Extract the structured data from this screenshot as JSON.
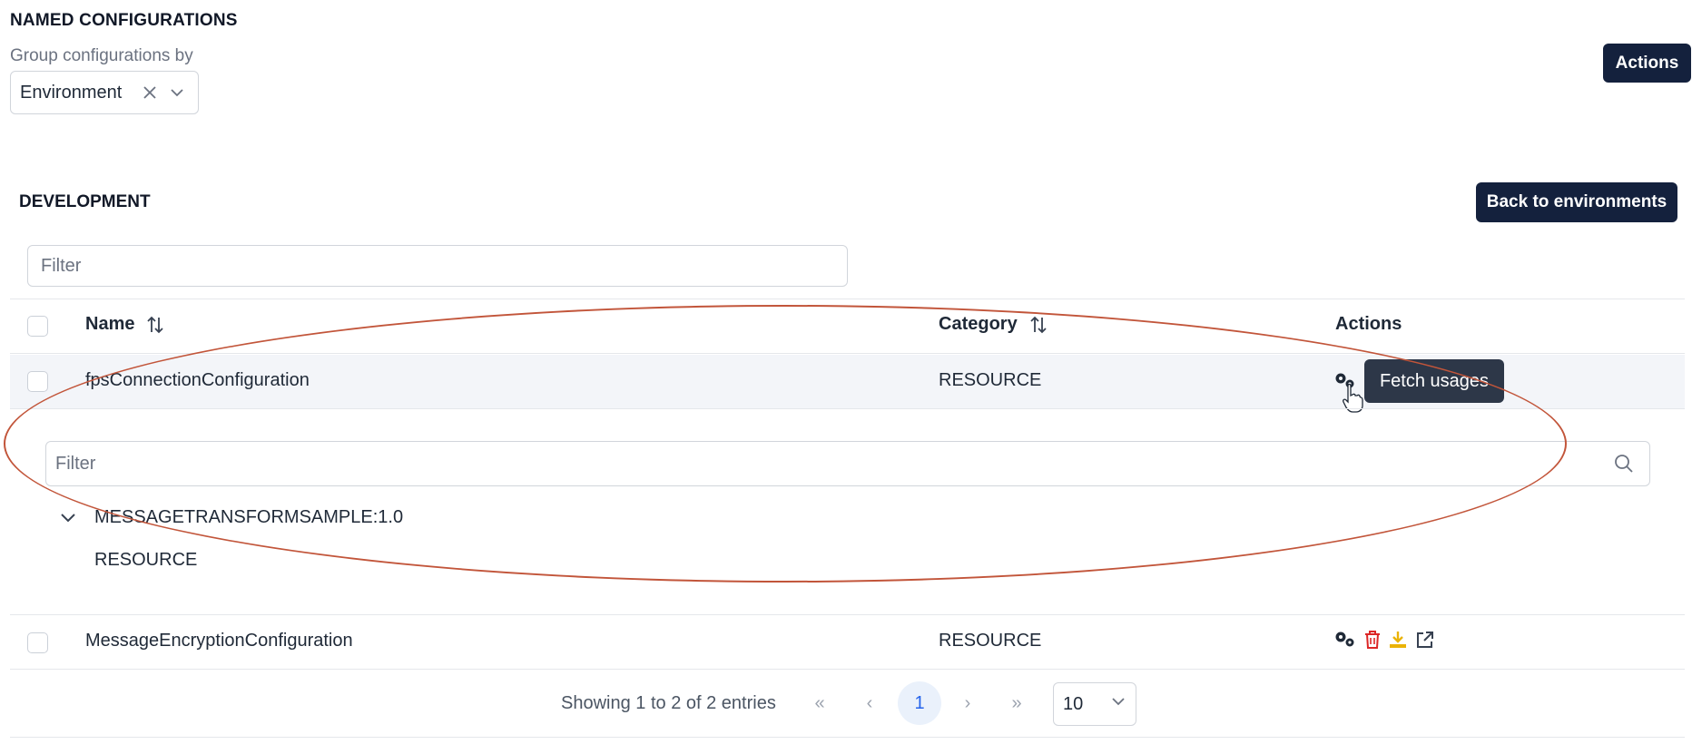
{
  "page": {
    "title": "NAMED CONFIGURATIONS",
    "group_label": "Group configurations by",
    "group_value": "Environment",
    "actions_label": "Actions"
  },
  "section": {
    "title": "DEVELOPMENT",
    "back_label": "Back to environments",
    "filter_placeholder": "Filter"
  },
  "table": {
    "columns": [
      "Name",
      "Category",
      "Actions"
    ],
    "rows": [
      {
        "name": "fpsConnectionConfiguration",
        "category": "RESOURCE"
      },
      {
        "name": "MessageEncryptionConfiguration",
        "category": "RESOURCE"
      }
    ],
    "tooltip": "Fetch usages"
  },
  "usages": {
    "filter_placeholder": "Filter",
    "items": [
      {
        "name": "MESSAGETRANSFORMSAMPLE:1.0",
        "type": "RESOURCE"
      }
    ]
  },
  "pagination": {
    "summary": "Showing 1 to 2 of 2 entries",
    "first": "«",
    "prev": "‹",
    "current": "1",
    "next": "›",
    "last": "»",
    "page_size": "10"
  },
  "colors": {
    "primary_button": "#14213d",
    "delete_icon": "#dc2626",
    "export_icon": "#eab308",
    "highlight_ellipse": "#c2553a",
    "tooltip_bg": "#2d3748"
  },
  "icons": {
    "clear": "close-icon",
    "dropdown": "chevron-down-icon",
    "sort": "sort-icon",
    "fetch_usages": "gears-icon",
    "delete": "trash-icon",
    "export": "download-icon",
    "open": "external-link-icon",
    "search": "search-icon",
    "expand": "chevron-down-icon",
    "cursor": "hand-pointer-icon"
  }
}
